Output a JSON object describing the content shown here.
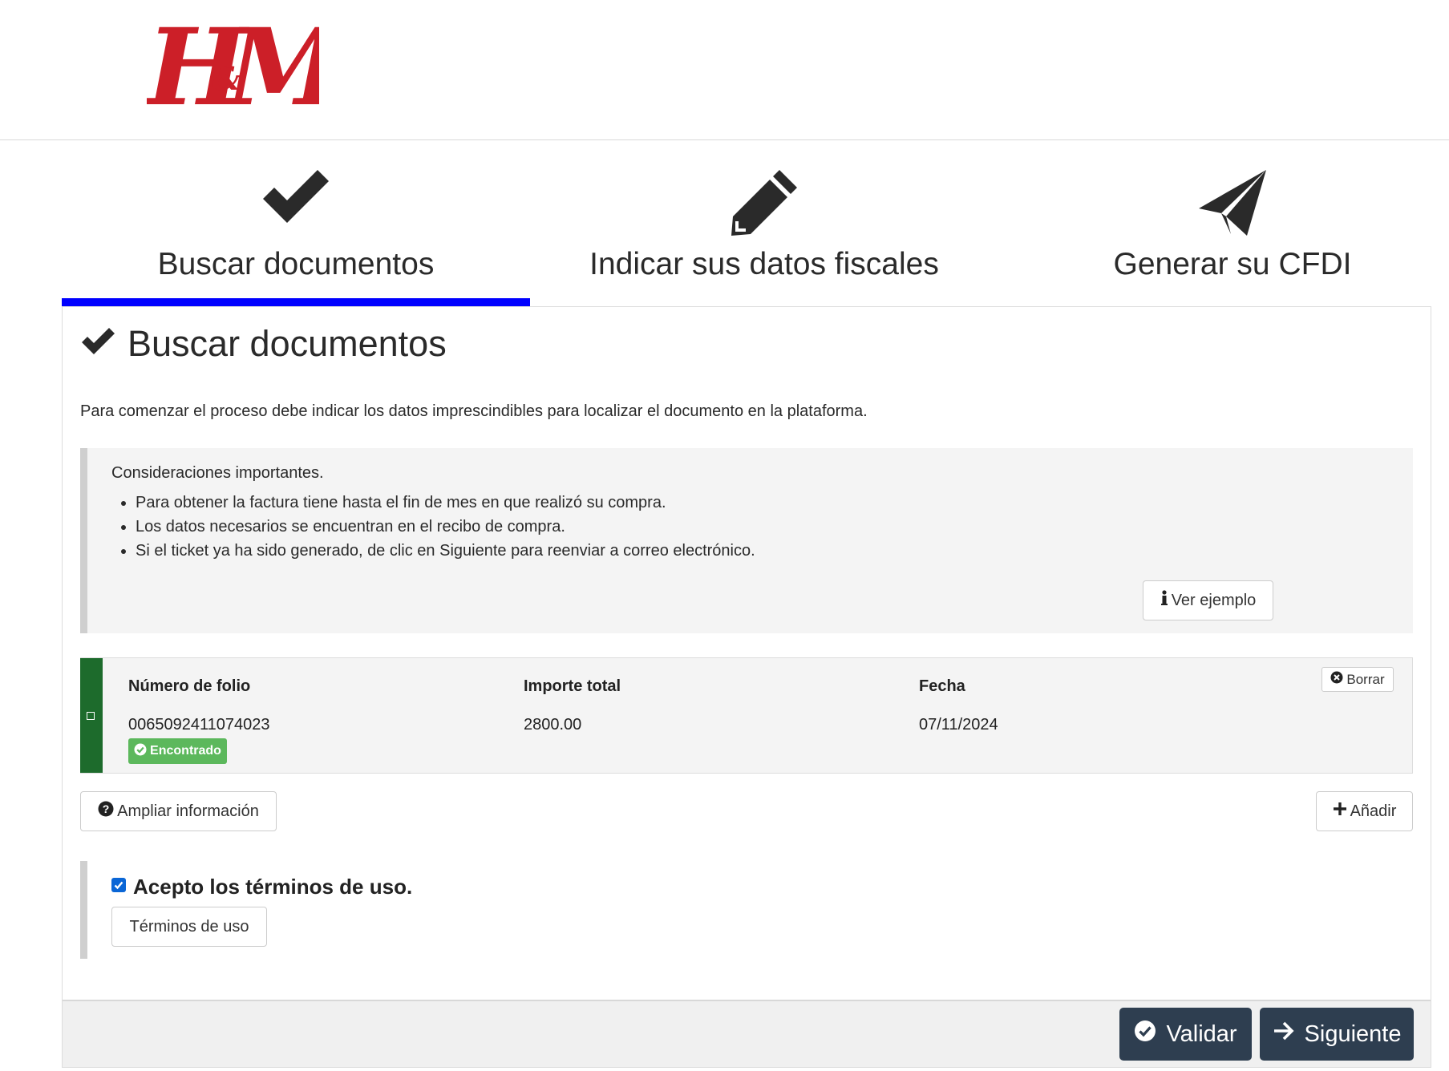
{
  "brand": {
    "logo_text": "H&M",
    "logo_color": "#cc1f28"
  },
  "steps": [
    {
      "label": "Buscar documentos",
      "icon": "check-icon",
      "active": true
    },
    {
      "label": "Indicar sus datos fiscales",
      "icon": "pencil-icon",
      "active": false
    },
    {
      "label": "Generar su CFDI",
      "icon": "paper-plane-icon",
      "active": false
    }
  ],
  "panel": {
    "title": "Buscar documentos",
    "intro": "Para comenzar el proceso debe indicar los datos imprescindibles para localizar el documento en la plataforma.",
    "notes": {
      "heading": "Consideraciones importantes.",
      "items": [
        "Para obtener la factura tiene hasta el fin de mes en que realizó su compra.",
        "Los datos necesarios se encuentran en el recibo de compra.",
        "Si el ticket ya ha sido generado, de clic en Siguiente para reenviar a correo electrónico."
      ],
      "example_button": "Ver ejemplo"
    },
    "document": {
      "headers": {
        "folio": "Número de folio",
        "total": "Importe total",
        "date": "Fecha"
      },
      "values": {
        "folio": "0065092411074023",
        "total": "2800.00",
        "date": "07/11/2024"
      },
      "status": "Encontrado",
      "delete_button": "Borrar"
    },
    "more_info_button": "Ampliar información",
    "add_button": "Añadir",
    "terms": {
      "checked": true,
      "label": "Acepto los términos de uso.",
      "button": "Términos de uso"
    },
    "footer": {
      "validate": "Validar",
      "next": "Siguiente"
    }
  },
  "colors": {
    "accent": "#0000ff",
    "found_side": "#1d6b2c",
    "badge": "#5cb85c",
    "dark_button": "#2e3e50"
  }
}
